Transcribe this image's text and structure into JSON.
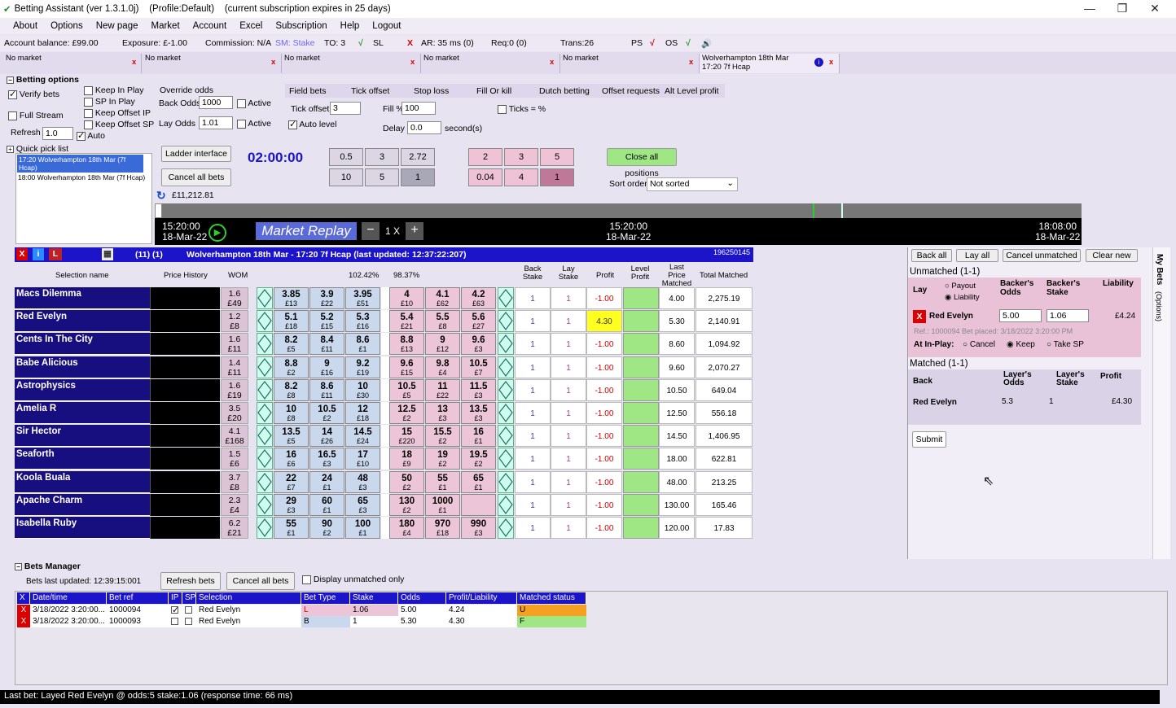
{
  "window": {
    "title": "Betting Assistant (ver 1.3.1.0j)    (Profile:Default)    (current subscription expires in 25 days)"
  },
  "menu": [
    "About",
    "Options",
    "New page",
    "Market",
    "Account",
    "Excel",
    "Subscription",
    "Help",
    "Logout"
  ],
  "status": {
    "balance": "Account balance: £99.00",
    "exposure": "Exposure: £-1.00",
    "commission": "Commission: N/A",
    "sm": "SM: Stake",
    "to": "TO: 3",
    "sl": "SL",
    "ar": "AR: 35 ms (0)",
    "req": "Req:0 (0)",
    "trans": "Trans:26",
    "ps": "PS",
    "os": "OS"
  },
  "tabs": [
    {
      "label": "No market"
    },
    {
      "label": "No market"
    },
    {
      "label": "No market"
    },
    {
      "label": "No market"
    },
    {
      "label": "No market"
    },
    {
      "label": "Wolverhampton 18th Mar\n17:20 7f Hcap"
    }
  ],
  "options": {
    "header": "Betting options",
    "verify": "Verify bets",
    "full_stream": "Full Stream",
    "refresh_label": "Refresh",
    "refresh_val": "1.0",
    "keep_inplay": "Keep In Play",
    "sp_inplay": "SP In Play",
    "keep_offset_ip": "Keep Offset IP",
    "keep_offset_sp": "Keep Offset SP",
    "auto": "Auto",
    "override": "Override odds",
    "back_odds": "Back Odds",
    "back_val": "1000",
    "lay_odds": "Lay Odds",
    "lay_val": "1.01",
    "active": "Active",
    "field_bets": "Field bets",
    "tick_offset": "Tick offset",
    "stop_loss": "Stop loss",
    "fill_or_kill": "Fill Or kill",
    "dutch": "Dutch betting",
    "offset_req": "Offset requests",
    "alt_level": "Alt Level profit",
    "tick_offset_lbl": "Tick offset",
    "tick_offset_val": "3",
    "fill_pct": "Fill %",
    "fill_val": "100",
    "ticks_pct": "Ticks = %",
    "auto_level": "Auto level",
    "delay": "Delay",
    "delay_val": "0.0",
    "seconds": "second(s)"
  },
  "quickpick": {
    "header": "Quick pick list",
    "items": [
      "17:20 Wolverhampton 18th Mar (7f Hcap)",
      "18:00 Wolverhampton 18th Mar (7f Hcap)"
    ]
  },
  "controls": {
    "ladder": "Ladder interface",
    "cancel_all": "Cancel all bets",
    "balance": "£11,212.81",
    "timer": "02:00:00",
    "back_stakes": [
      "0.5",
      "3",
      "2.72",
      "10",
      "5",
      "1"
    ],
    "lay_stakes": [
      "2",
      "3",
      "5",
      "0.04",
      "4",
      "1"
    ],
    "close_all": "Close all positions",
    "sort_order": "Sort order",
    "sort_val": "Not sorted"
  },
  "replay": {
    "left_time": "15:20:00",
    "left_date": "18-Mar-22",
    "label": "Market Replay",
    "speed": "1 X",
    "mid_time": "15:20:00",
    "mid_date": "18-Mar-22",
    "right_time": "18:08:00",
    "right_date": "18-Mar-22"
  },
  "market": {
    "header": "(11) (1)",
    "title": "Wolverhampton 18th Mar - 17:20 7f Hcap (last updated: 12:37:22:207)",
    "id": "196250145",
    "col_selection": "Selection name",
    "col_history": "Price History",
    "col_wom": "WOM",
    "book_back": "102.42%",
    "book_lay": "98.37%",
    "col_back_stake": "Back Stake",
    "col_lay_stake": "Lay Stake",
    "col_profit": "Profit",
    "col_level": "Level Profit",
    "col_last": "Last Price Matched",
    "col_total": "Total Matched"
  },
  "runners": [
    {
      "name": "Macs Dilemma",
      "wom": "1.6",
      "womv": "£49",
      "b": [
        [
          "3.85",
          "£13"
        ],
        [
          "3.9",
          "£22"
        ],
        [
          "3.95",
          "£51"
        ]
      ],
      "l": [
        [
          "4",
          "£10"
        ],
        [
          "4.1",
          "£62"
        ],
        [
          "4.2",
          "£63"
        ]
      ],
      "bs": "1",
      "ls": "1",
      "profit": "-1.00",
      "last": "4.00",
      "total": "2,275.19"
    },
    {
      "name": "Red Evelyn",
      "wom": "1.2",
      "womv": "£8",
      "b": [
        [
          "5.1",
          "£18"
        ],
        [
          "5.2",
          "£15"
        ],
        [
          "5.3",
          "£16"
        ]
      ],
      "l": [
        [
          "5.4",
          "£21"
        ],
        [
          "5.5",
          "£8"
        ],
        [
          "5.6",
          "£27"
        ]
      ],
      "bs": "1",
      "ls": "1",
      "profit": "4.30",
      "last": "5.30",
      "total": "2,140.91"
    },
    {
      "name": "Cents In The City",
      "wom": "1.6",
      "womv": "£11",
      "b": [
        [
          "8.2",
          "£5"
        ],
        [
          "8.4",
          "£11"
        ],
        [
          "8.6",
          "£1"
        ]
      ],
      "l": [
        [
          "8.8",
          "£13"
        ],
        [
          "9",
          "£12"
        ],
        [
          "9.6",
          "£3"
        ]
      ],
      "bs": "1",
      "ls": "1",
      "profit": "-1.00",
      "last": "8.60",
      "total": "1,094.92"
    },
    {
      "name": "Babe Alicious",
      "wom": "1.4",
      "womv": "£11",
      "b": [
        [
          "8.8",
          "£2"
        ],
        [
          "9",
          "£16"
        ],
        [
          "9.2",
          "£19"
        ]
      ],
      "l": [
        [
          "9.6",
          "£15"
        ],
        [
          "9.8",
          "£4"
        ],
        [
          "10.5",
          "£7"
        ]
      ],
      "bs": "1",
      "ls": "1",
      "profit": "-1.00",
      "last": "9.60",
      "total": "2,070.27"
    },
    {
      "name": "Astrophysics",
      "wom": "1.6",
      "womv": "£19",
      "b": [
        [
          "8.2",
          "£8"
        ],
        [
          "8.6",
          "£11"
        ],
        [
          "10",
          "£30"
        ]
      ],
      "l": [
        [
          "10.5",
          "£5"
        ],
        [
          "11",
          "£22"
        ],
        [
          "11.5",
          "£3"
        ]
      ],
      "bs": "1",
      "ls": "1",
      "profit": "-1.00",
      "last": "10.50",
      "total": "649.04"
    },
    {
      "name": "Amelia R",
      "wom": "3.5",
      "womv": "£20",
      "b": [
        [
          "10",
          "£8"
        ],
        [
          "10.5",
          "£2"
        ],
        [
          "12",
          "£18"
        ]
      ],
      "l": [
        [
          "12.5",
          "£2"
        ],
        [
          "13",
          "£3"
        ],
        [
          "13.5",
          "£3"
        ]
      ],
      "bs": "1",
      "ls": "1",
      "profit": "-1.00",
      "last": "12.50",
      "total": "556.18"
    },
    {
      "name": "Sir Hector",
      "wom": "4.1",
      "womv": "£168",
      "b": [
        [
          "13.5",
          "£5"
        ],
        [
          "14",
          "£26"
        ],
        [
          "14.5",
          "£24"
        ]
      ],
      "l": [
        [
          "15",
          "£220"
        ],
        [
          "15.5",
          "£2"
        ],
        [
          "16",
          "£1"
        ]
      ],
      "bs": "1",
      "ls": "1",
      "profit": "-1.00",
      "last": "14.50",
      "total": "1,406.95"
    },
    {
      "name": "Seaforth",
      "wom": "1.5",
      "womv": "£6",
      "b": [
        [
          "16",
          "£6"
        ],
        [
          "16.5",
          "£3"
        ],
        [
          "17",
          "£10"
        ]
      ],
      "l": [
        [
          "18",
          "£9"
        ],
        [
          "19",
          "£2"
        ],
        [
          "19.5",
          "£2"
        ]
      ],
      "bs": "1",
      "ls": "1",
      "profit": "-1.00",
      "last": "18.00",
      "total": "622.81"
    },
    {
      "name": "Koola Buala",
      "wom": "3.7",
      "womv": "£8",
      "b": [
        [
          "22",
          "£7"
        ],
        [
          "24",
          "£1"
        ],
        [
          "48",
          "£3"
        ]
      ],
      "l": [
        [
          "50",
          "£2"
        ],
        [
          "55",
          "£1"
        ],
        [
          "65",
          "£1"
        ]
      ],
      "bs": "1",
      "ls": "1",
      "profit": "-1.00",
      "last": "48.00",
      "total": "213.25"
    },
    {
      "name": "Apache Charm",
      "wom": "2.3",
      "womv": "£4",
      "b": [
        [
          "29",
          "£3"
        ],
        [
          "60",
          "£1"
        ],
        [
          "65",
          "£3"
        ]
      ],
      "l": [
        [
          "130",
          "£2"
        ],
        [
          "1000",
          "£1"
        ],
        [
          "",
          ""
        ]
      ],
      "bs": "1",
      "ls": "1",
      "profit": "-1.00",
      "last": "130.00",
      "total": "165.46"
    },
    {
      "name": "Isabella Ruby",
      "wom": "6.2",
      "womv": "£21",
      "b": [
        [
          "55",
          "£1"
        ],
        [
          "90",
          "£2"
        ],
        [
          "100",
          "£1"
        ]
      ],
      "l": [
        [
          "180",
          "£4"
        ],
        [
          "970",
          "£18"
        ],
        [
          "990",
          "£3"
        ]
      ],
      "bs": "1",
      "ls": "1",
      "profit": "-1.00",
      "last": "120.00",
      "total": "17.83"
    }
  ],
  "mybets": {
    "back_all": "Back all",
    "lay_all": "Lay all",
    "cancel_unmatched": "Cancel unmatched",
    "clear_new": "Clear new",
    "unmatched": "Unmatched (1-1)",
    "lay": "Lay",
    "payout": "Payout",
    "liability": "Liability",
    "backers_odds": "Backer's Odds",
    "backers_stake": "Backer's Stake",
    "liability_hdr": "Liability",
    "bet_runner": "Red Evelyn",
    "bet_odds": "5.00",
    "bet_stake": "1.06",
    "bet_liab": "£4.24",
    "ref": "Ref.: 1000094 Bet placed: 3/18/2022 3:20:00 PM",
    "inplay": "At In-Play:",
    "cancel": "Cancel",
    "keep": "Keep",
    "take_sp": "Take SP",
    "matched": "Matched (1-1)",
    "back": "Back",
    "layers_odds": "Layer's Odds",
    "layers_stake": "Layer's Stake",
    "profit": "Profit",
    "m_runner": "Red Evelyn",
    "m_odds": "5.3",
    "m_stake": "1",
    "m_profit": "£4.30",
    "submit": "Submit",
    "side_label": "My Bets",
    "side_opt": "(Options)"
  },
  "betsmgr": {
    "header": "Bets Manager",
    "updated": "Bets last updated: 12:39:15:001",
    "refresh": "Refresh bets",
    "cancel": "Cancel all bets",
    "unmatched_only": "Display unmatched only",
    "cols": [
      "X",
      "Date/time",
      "Bet ref",
      "IP",
      "SP",
      "Selection",
      "Bet Type",
      "Stake",
      "Odds",
      "Profit/Liability",
      "Matched status"
    ],
    "rows": [
      [
        "3/18/2022 3:20:00...",
        "1000094",
        "Red Evelyn",
        "L",
        "1.06",
        "5.00",
        "4.24",
        "U"
      ],
      [
        "3/18/2022 3:20:00...",
        "1000093",
        "Red Evelyn",
        "B",
        "1",
        "5.30",
        "4.30",
        "F"
      ]
    ]
  },
  "footer": {
    "last_bet": "Last bet: Layed Red Evelyn @ odds:5 stake:1.06 (response time: 66 ms)"
  },
  "colors": {
    "accent": "#1b14c8",
    "name_bg": "#170f80",
    "back": "#c9d8ec",
    "lay": "#ecc6d8",
    "level": "#9fe685",
    "unmatched": "#f5a020",
    "matched": "#9fe685"
  }
}
